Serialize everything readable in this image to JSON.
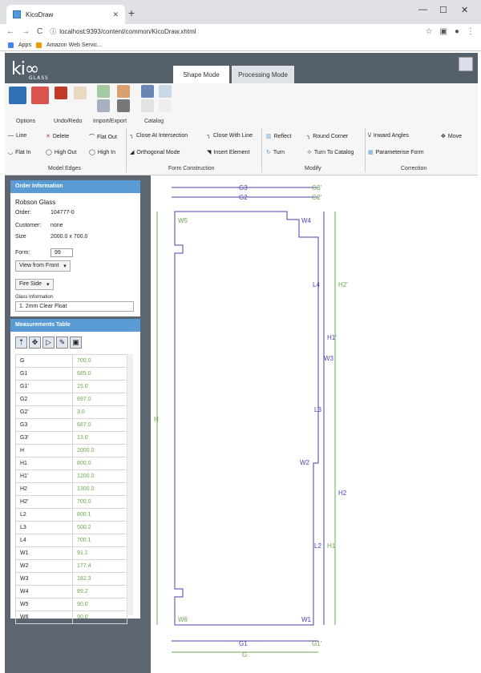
{
  "browser": {
    "tab_title": "KicoDraw",
    "url": "localhost:9393/content/common/KicoDraw.xhtml",
    "bookmarks": [
      {
        "label": "Apps",
        "color": "#4285f4"
      },
      {
        "label": "Amazon Web Servic...",
        "color": "#f29900"
      }
    ]
  },
  "app": {
    "logo": "ki∞",
    "logo_sub": "GLASS",
    "modes": [
      "Shape Mode",
      "Processing Mode"
    ]
  },
  "ribbon": {
    "groups": [
      "Options",
      "Undo/Redo",
      "Import/Export",
      "Catalog"
    ],
    "edge_tools": [
      [
        "Line",
        "Delete",
        "Flat Out"
      ],
      [
        "Flat In",
        "High Out",
        "High In"
      ]
    ],
    "construction_tools": [
      [
        "Close At Intersection",
        "Close With Line"
      ],
      [
        "Orthogonal Mode",
        "Insert Element"
      ]
    ],
    "modify_tools": [
      [
        "Reflect",
        "Round Corner"
      ],
      [
        "Turn",
        "Turn To Catalog"
      ]
    ],
    "correction_tools": [
      [
        "Inward Angles",
        "Move"
      ],
      [
        "Parameterise Form"
      ]
    ],
    "section_labels": [
      "Model Edges",
      "Form Construction",
      "Modify",
      "Correction"
    ]
  },
  "order": {
    "header": "Order Information",
    "company": "Robson Glass",
    "rows": [
      {
        "k": "Order:",
        "v": "104777-0"
      },
      {
        "k": "Customer:",
        "v": "none"
      },
      {
        "k": "Size",
        "v": "2000.0 x 700.0"
      }
    ],
    "form_label": "Form:",
    "form_value": "99",
    "view": "View from Front",
    "side": "Fire Side",
    "glass_label": "Glass Information",
    "glass_value": "1. 2mm Clear Float"
  },
  "measurements": {
    "header": "Measurements Table",
    "rows": [
      [
        "G",
        "700.0"
      ],
      [
        "G1",
        "685.0"
      ],
      [
        "G1'",
        "15.0"
      ],
      [
        "G2",
        "697.0"
      ],
      [
        "G2'",
        "3.0"
      ],
      [
        "G3",
        "687.0"
      ],
      [
        "G3'",
        "13.0"
      ],
      [
        "H",
        "2000.0"
      ],
      [
        "H1",
        "800.0"
      ],
      [
        "H1'",
        "1200.0"
      ],
      [
        "H2",
        "1300.0"
      ],
      [
        "H2'",
        "700.0"
      ],
      [
        "L2",
        "800.1"
      ],
      [
        "L3",
        "500.2"
      ],
      [
        "L4",
        "700.1"
      ],
      [
        "W1",
        "91.1"
      ],
      [
        "W2",
        "177.4"
      ],
      [
        "W3",
        "182.3"
      ],
      [
        "W4",
        "89.2"
      ],
      [
        "W5",
        "90.0"
      ],
      [
        "W6",
        "90.0"
      ]
    ]
  },
  "drawing": {
    "top_dims": [
      [
        "G3",
        "G3'"
      ],
      [
        "G2",
        "G2'"
      ]
    ],
    "bottom_dims": [
      [
        "G1",
        "G1'"
      ],
      [
        "G"
      ]
    ],
    "corner_labels": [
      "W5",
      "W4",
      "W6",
      "W1"
    ],
    "edge_labels": [
      "L4",
      "W3",
      "L3",
      "W2",
      "L2"
    ],
    "right_dims": [
      "H2'",
      "H1'",
      "H2",
      "H1"
    ],
    "left_dim": "H"
  },
  "colors": {
    "dim_purple": "#4b3fb3",
    "dim_green": "#6aa84f",
    "panel": "#5d6670",
    "header": "#5a9bd5"
  }
}
